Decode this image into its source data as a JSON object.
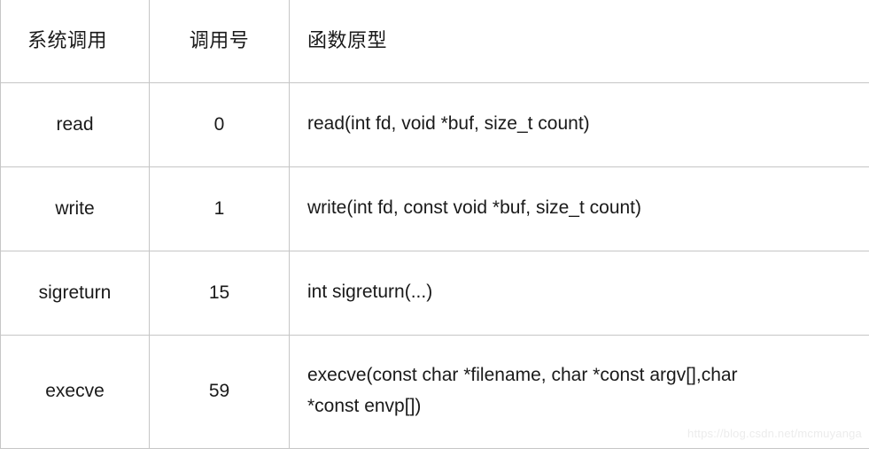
{
  "table": {
    "columns": [
      {
        "key": "name",
        "header": "系统调用",
        "align": "left"
      },
      {
        "key": "num",
        "header": "调用号",
        "align": "center"
      },
      {
        "key": "proto",
        "header": "函数原型",
        "align": "left"
      }
    ],
    "rows": [
      {
        "name": "read",
        "num": "0",
        "proto_lines": [
          "read(int fd, void *buf, size_t count)"
        ]
      },
      {
        "name": "write",
        "num": "1",
        "proto_lines": [
          "write(int fd, const void *buf, size_t count)"
        ]
      },
      {
        "name": "sigreturn",
        "num": "15",
        "proto_lines": [
          "int sigreturn(...)"
        ]
      },
      {
        "name": "execve",
        "num": "59",
        "proto_lines": [
          "execve(const char *filename, char *const argv[],char",
          "*const envp[])"
        ]
      }
    ]
  },
  "watermark": {
    "text": "https://blog.csdn.net/mcmuyanga"
  },
  "colors": {
    "border": "#c6c6c6",
    "text": "#1a1a1a",
    "background": "#ffffff",
    "watermark": "#ececec"
  }
}
